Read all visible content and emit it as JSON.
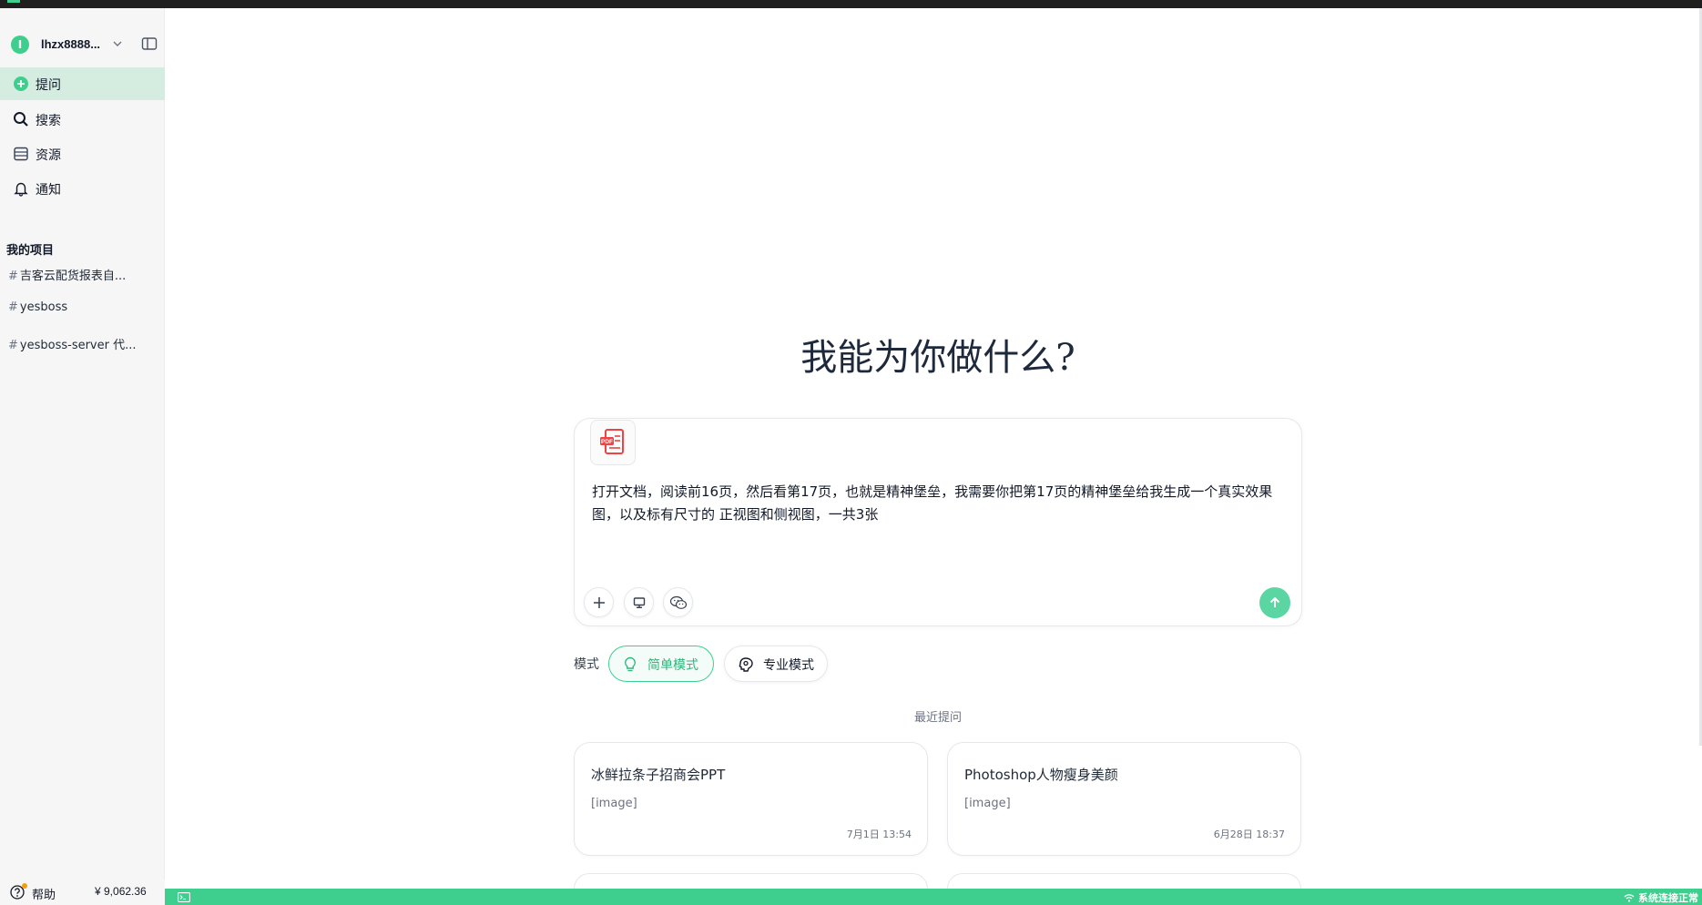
{
  "user": {
    "initial": "I",
    "name": "lhzx8888..."
  },
  "nav": [
    {
      "id": "ask",
      "label": "提问"
    },
    {
      "id": "search",
      "label": "搜索"
    },
    {
      "id": "resources",
      "label": "资源"
    },
    {
      "id": "notifications",
      "label": "通知"
    }
  ],
  "projects": {
    "title": "我的项目",
    "items": [
      {
        "hash": "#",
        "name": "吉客云配货报表自..."
      },
      {
        "hash": "#",
        "name": "yesboss"
      },
      {
        "hash": "#",
        "name": "yesboss-server 代..."
      }
    ]
  },
  "footer": {
    "help_label": "帮助",
    "balance": "¥ 9,062.36"
  },
  "main": {
    "hero_title": "我能为你做什么?",
    "composer": {
      "attachment_badge": "PDF",
      "prompt_text": "打开文档，阅读前16页，然后看第17页，也就是精神堡垒，我需要你把第17页的精神堡垒给我生成一个真实效果图，以及标有尺寸的 正视图和侧视图，一共3张"
    },
    "mode": {
      "label": "模式",
      "simple": "简单模式",
      "pro": "专业模式"
    },
    "recent": {
      "title": "最近提问",
      "cards": [
        {
          "title": "冰鲜拉条子招商会PPT",
          "sub": "[image]",
          "time": "7月1日 13:54"
        },
        {
          "title": "Photoshop人物瘦身美颜",
          "sub": "[image]",
          "time": "6月28日 18:37"
        }
      ]
    }
  },
  "statusbar": {
    "text": "系统连接正常"
  },
  "colors": {
    "accent": "#3ecf8e",
    "active_nav": "#d5ece1",
    "send": "#5bd6a2"
  }
}
